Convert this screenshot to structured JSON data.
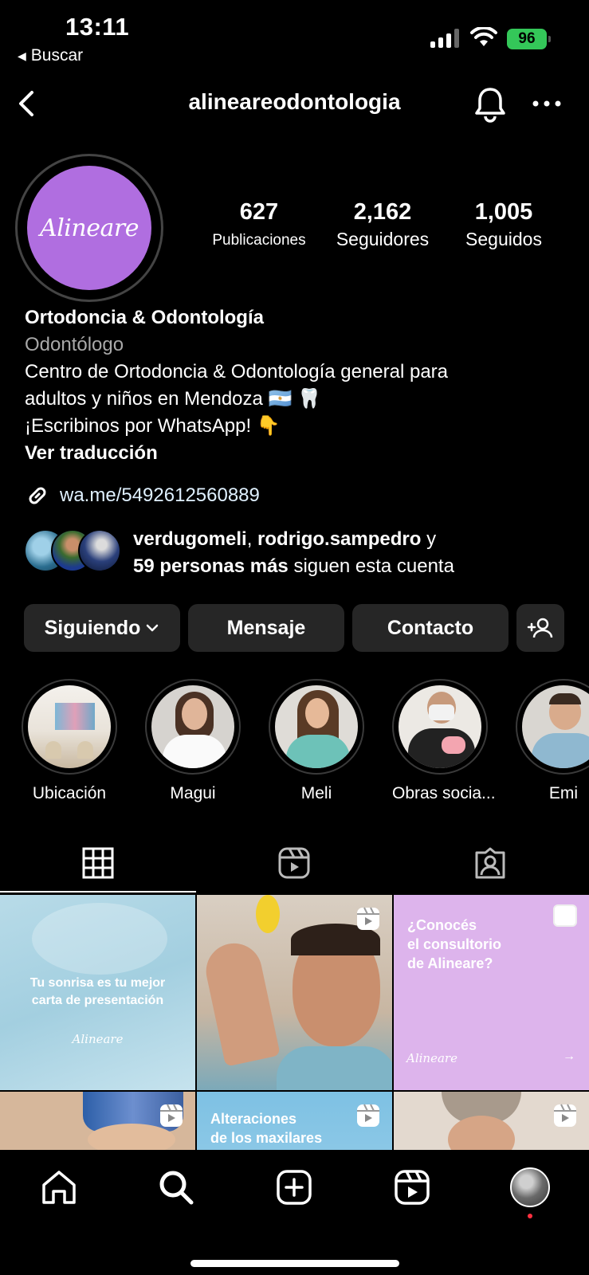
{
  "status_bar": {
    "time": "13:11",
    "back_app": "Buscar",
    "battery": "96"
  },
  "header": {
    "username": "alineareodontologia"
  },
  "profile": {
    "avatar_text": "Alineare",
    "stats": [
      {
        "value": "627",
        "label": "Publicaciones"
      },
      {
        "value": "2,162",
        "label": "Seguidores"
      },
      {
        "value": "1,005",
        "label": "Seguidos"
      }
    ],
    "display_name": "Ortodoncia & Odontología",
    "category": "Odontólogo",
    "bio_line1": "Centro de Ortodoncia & Odontología general para",
    "bio_line2": "adultos y niños en Mendoza 🇦🇷 🦷",
    "bio_line3": "¡Escribinos por WhatsApp!  👇",
    "translate": "Ver traducción",
    "link": "wa.me/5492612560889"
  },
  "followed_by": {
    "user1": "verdugomeli",
    "sep": ", ",
    "user2": "rodrigo.sampedro",
    "and": " y",
    "more": "59 personas más",
    "suffix": " siguen esta cuenta"
  },
  "actions": {
    "following": "Siguiendo",
    "message": "Mensaje",
    "contact": "Contacto"
  },
  "highlights": [
    {
      "label": "Ubicación"
    },
    {
      "label": "Magui"
    },
    {
      "label": "Meli"
    },
    {
      "label": "Obras socia..."
    },
    {
      "label": "Emi"
    }
  ],
  "posts": {
    "post1_line1": "Tu sonrisa es tu mejor",
    "post1_line2": "carta de presentación",
    "post1_logo": "Alineare",
    "post3_line1": "¿Conocés",
    "post3_line2": "el consultorio",
    "post3_line3": "de Alineare?",
    "post3_logo": "Alineare",
    "post5_line1": "Alteraciones",
    "post5_line2": "de los maxilares"
  },
  "colors": {
    "avatar_bg": "#b06ee0",
    "button_bg": "#262626",
    "battery": "#34c759",
    "notification_dot": "#ff3040"
  }
}
